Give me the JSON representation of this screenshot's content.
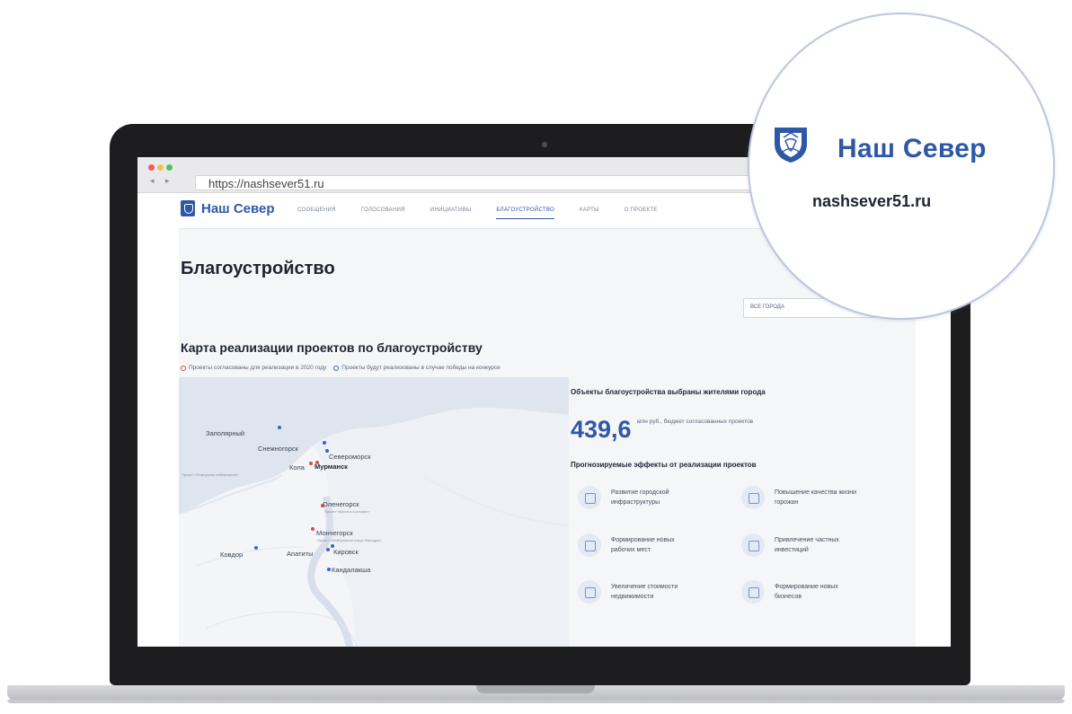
{
  "browser": {
    "url": "https://nashsever51.ru"
  },
  "site": {
    "logo_text": "Наш Север",
    "nav": [
      "СООБЩЕНИЯ",
      "ГОЛОСОВАНИЯ",
      "ИНИЦИАТИВЫ",
      "БЛАГОУСТРОЙСТВО",
      "КАРТЫ",
      "О ПРОЕКТЕ"
    ],
    "active_nav": "БЛАГОУСТРОЙСТВО",
    "page_title": "Благоустройство",
    "city_select": "ВСЕ ГОРОДА",
    "section_title": "Карта реализации проектов по благоустройству",
    "legend": [
      "Проекты согласованы для реализации в 2020 году",
      "Проекты будут реализованы в случае победы на конкурсе"
    ],
    "map": {
      "cities": [
        {
          "name": "Заполярный",
          "dot": "blue"
        },
        {
          "name": "Снежногорск",
          "dot": "blue"
        },
        {
          "name": "Североморск",
          "dot": "blue"
        },
        {
          "name": "Кола",
          "dot": "red"
        },
        {
          "name": "Мурманск",
          "dot": "red"
        },
        {
          "name": "Оленегорск",
          "dot": "red"
        },
        {
          "name": "Мончегорск",
          "dot": "red"
        },
        {
          "name": "Апатиты",
          "dot": "blue"
        },
        {
          "name": "Кировск",
          "dot": "blue"
        },
        {
          "name": "Ковдор",
          "dot": "blue"
        },
        {
          "name": "Кандалакша",
          "dot": "blue"
        }
      ],
      "project_notes": [
        "Проект «Поморская набережная»",
        "Проект «Бухта в сосновке»",
        "Проект «Набережная озера Имандра»"
      ]
    },
    "info": {
      "title": "Объекты благоустройства выбраны жителями города",
      "budget_value": "439,6",
      "budget_desc": "млн руб., бюджет согласованных проектов",
      "effects_title": "Прогнозируемые эффекты от реализации проектов",
      "effects": [
        {
          "text": "Развитие городской инфраструктуры",
          "icon": "infrastructure-icon"
        },
        {
          "text": "Повышение качества жизни горожан",
          "icon": "quality-of-life-icon"
        },
        {
          "text": "Формирование новых рабочих мест",
          "icon": "briefcase-icon"
        },
        {
          "text": "Привлечение частных инвестиций",
          "icon": "investment-icon"
        },
        {
          "text": "Увеличение стоимости недвижимости",
          "icon": "building-icon"
        },
        {
          "text": "Формирование новых бизнесов",
          "icon": "shop-icon"
        }
      ]
    }
  },
  "magnifier": {
    "title": "Наш Север",
    "domain": "nashsever51.ru"
  },
  "colors": {
    "brand": "#2e58a6",
    "red_marker": "#d64b4b",
    "blue_marker": "#3565c9"
  }
}
